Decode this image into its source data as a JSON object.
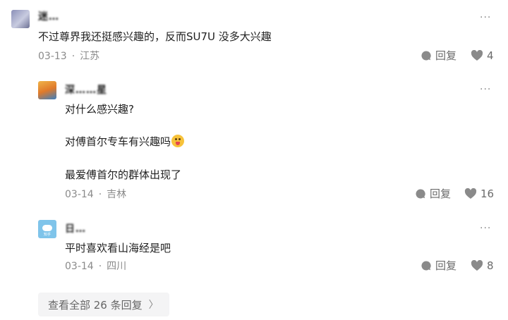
{
  "comment": {
    "username": "迷…",
    "text": "不过尊界我还挺感兴趣的，反而SU7U 没多大兴趣",
    "date": "03-13",
    "location": "江苏",
    "reply_label": "回复",
    "like_count": "4",
    "more": "···"
  },
  "replies": [
    {
      "username": "深……星",
      "lines": [
        "对什么感兴趣?",
        "对傅首尔专车有兴趣吗",
        "最爱傅首尔的群体出现了"
      ],
      "emoji_name": "drooling-face-emoji",
      "date": "03-14",
      "location": "吉林",
      "reply_label": "回复",
      "like_count": "16",
      "more": "···"
    },
    {
      "username": "日…",
      "avatar_caption": "知乎",
      "lines": [
        "平时喜欢看山海经是吧"
      ],
      "date": "03-14",
      "location": "四川",
      "reply_label": "回复",
      "like_count": "8",
      "more": "···"
    }
  ],
  "view_all": {
    "label": "查看全部 26 条回复",
    "chevron": "〉"
  },
  "colors": {
    "text": "#1f1f1f",
    "meta": "#8a8a8a",
    "button_bg": "#f4f4f5"
  },
  "meta_separator": "·"
}
